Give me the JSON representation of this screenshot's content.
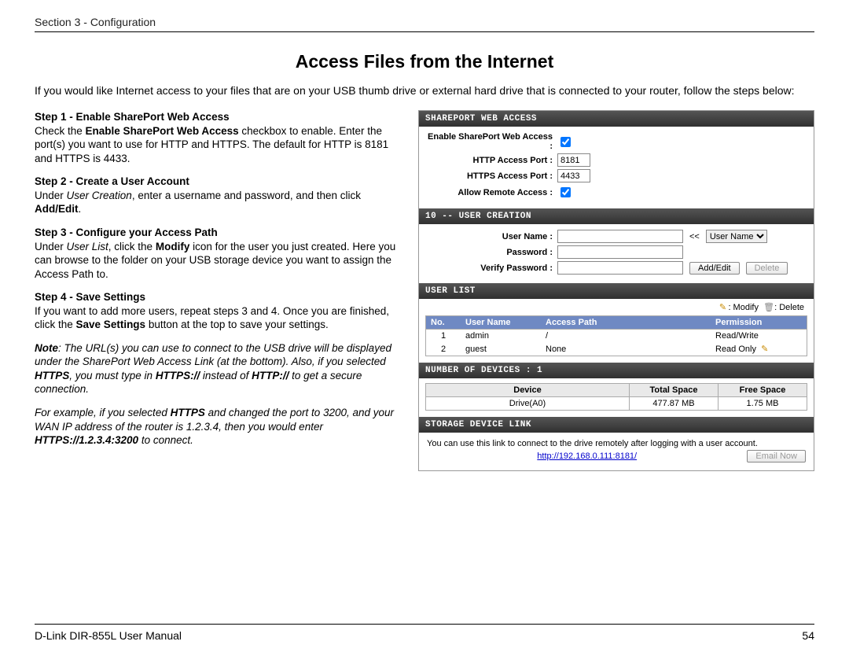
{
  "header": {
    "section": "Section 3 - Configuration"
  },
  "title": "Access Files from the Internet",
  "intro": "If you would like Internet access to your files that are on your USB thumb drive or external hard drive that is connected to your router, follow the steps below:",
  "steps": {
    "s1_title": "Step 1 - Enable SharePort Web Access",
    "s1_a": "Check the ",
    "s1_b": "Enable SharePort Web Access",
    "s1_c": " checkbox to enable. Enter the port(s) you want to use for HTTP and HTTPS. The default for HTTP is 8181 and HTTPS is 4433.",
    "s2_title": "Step 2 - Create a User Account",
    "s2_a": "Under ",
    "s2_b": "User Creation",
    "s2_c": ", enter a username and password, and then click ",
    "s2_d": "Add/Edit",
    "s2_e": ".",
    "s3_title": "Step 3 - Configure your Access Path",
    "s3_a": "Under ",
    "s3_b": "User List",
    "s3_c": ", click the ",
    "s3_d": "Modify",
    "s3_e": " icon for the user you just created. Here you can browse to the folder on your USB storage device you want to assign the Access Path to.",
    "s4_title": "Step 4 - Save Settings",
    "s4_a": "If you want to add more users, repeat steps 3 and 4. Once you are finished, click the ",
    "s4_b": "Save Settings",
    "s4_c": " button at the top to save your settings.",
    "note_lead": "Note",
    "note1_a": ": The URL(s) you can use to connect to the USB drive will be displayed under the SharePort Web Access Link (at the bottom). Also, if you selected ",
    "note1_b": "HTTPS",
    "note1_c": ", you must type in ",
    "note1_d": "HTTPS://",
    "note1_e": " instead of ",
    "note1_f": "HTTP://",
    "note1_g": " to get a secure connection.",
    "note2_a": "For example, if you selected ",
    "note2_b": "HTTPS",
    "note2_c": " and changed the port to 3200, and your WAN IP address of the router is 1.2.3.4, then you would enter ",
    "note2_d": "HTTPS://1.2.3.4:3200",
    "note2_e": " to connect."
  },
  "panel": {
    "h1": "SHAREPORT WEB ACCESS",
    "enable_lbl": "Enable SharePort Web Access :",
    "enable_checked": true,
    "http_lbl": "HTTP Access Port :",
    "http_val": "8181",
    "https_lbl": "HTTPS Access Port :",
    "https_val": "4433",
    "remote_lbl": "Allow Remote Access :",
    "remote_checked": true,
    "h2": "10 -- USER CREATION",
    "uname_lbl": "User Name :",
    "uname_val": "",
    "pw_lbl": "Password :",
    "pw_val": "",
    "vpw_lbl": "Verify Password :",
    "vpw_val": "",
    "laquo": "<<",
    "select_user": "User Name",
    "btn_addedit": "Add/Edit",
    "btn_delete": "Delete",
    "h3": "USER LIST",
    "legend_modify": ": Modify",
    "legend_delete": ": Delete",
    "cols": {
      "no": "No.",
      "user": "User Name",
      "path": "Access Path",
      "perm": "Permission"
    },
    "rows": [
      {
        "no": "1",
        "user": "admin",
        "path": "/",
        "perm": "Read/Write",
        "modify": false
      },
      {
        "no": "2",
        "user": "guest",
        "path": "None",
        "perm": "Read Only",
        "modify": true
      }
    ],
    "h4": "NUMBER OF DEVICES : 1",
    "dev_cols": {
      "device": "Device",
      "total": "Total Space",
      "free": "Free Space"
    },
    "dev_rows": [
      {
        "device": "Drive(A0)",
        "total": "477.87 MB",
        "free": "1.75 MB"
      }
    ],
    "h5": "STORAGE DEVICE LINK",
    "storage_desc": "You can use this link to connect to the drive remotely after logging with a user account.",
    "link": "http://192.168.0.111:8181/",
    "btn_email": "Email Now"
  },
  "footer": {
    "left": "D-Link DIR-855L User Manual",
    "right": "54"
  }
}
